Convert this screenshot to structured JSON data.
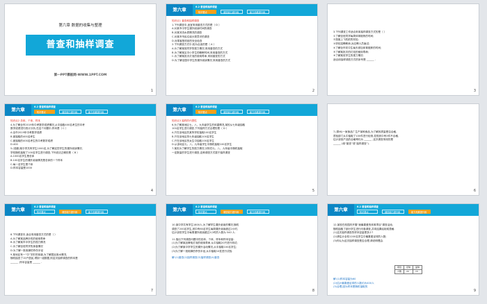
{
  "header": {
    "chapter": "第六章",
    "section": "6.2 普查和抽样调查",
    "tabs": [
      "知识要点",
      "课堂能力提升练",
      "能力拓展提升练"
    ]
  },
  "slides": [
    {
      "num": "1",
      "crumb": "第六章 数据的收集与整理",
      "title": "普查和抽样调查",
      "site": "第一PPT模板网-WWW.1PPT.COM"
    },
    {
      "num": "2",
      "lines": [
        "知识点1 普查和抽样调查",
        "1.下列调查中,适宜采用普查方式的是（ D ）",
        "A.对某市中学生课外阅读时间的调查",
        "B.对某河流水质情况的调查",
        "C.对某市市民垃圾分类意识的调查",
        "D.对乘客登机前的安全检查",
        "2.下列调查方式中,较为合适的是（ A ）",
        "A.为了解某班同学的视力情况,采用普查的方式",
        "B.为了解某区中小学生的睡眠时间,采用普查的方式",
        "C.为了解某批次灯泡的使用寿命,采用普查的方式",
        "D.为了解全国中学生的课外阅读情况,采用普查的方式"
      ]
    },
    {
      "num": "3",
      "lines": [
        "3.下列调查工作适合采用抽样调查方式的是（ ）",
        "①了解全班同学每周体育锻炼的时间;",
        "②旅客上飞机前的安检;",
        "③学校招聘教师,对应聘人员面试;",
        "④了解全市初中生每天参加体育锻炼的时间;",
        "⑤了解某批次的灯泡的使用寿命;",
        "⑥了解某班学生的视力情况.",
        "适合用抽样调查方式的序号是 ______ ."
      ]
    },
    {
      "num": "4",
      "lines": [
        "知识点2 总体、个体、样本",
        "4.为了解全市2019年中考数学成绩情况,从中抽取400名考生的中考",
        "数学成绩进行统计分析,在这个问题中,样本是（ C ）",
        "A.全市2019年中考数学成绩",
        "B.被抽取的400名考生",
        "C.被抽取的400名考生的中考数学成绩",
        "D.400",
        "5.(成都)某中学共有学生1000名,为了解这些学生的课外阅读情况,",
        "学校随机抽取了100名学生进行调查,下列说法正确的是（ B ）",
        "A.1000名学生是总体",
        "B.100名学生的课外阅读情况是总体的一个样本",
        "C.每一名学生是个体",
        "D.样本容量是1000"
      ]
    },
    {
      "num": "5",
      "lines": [
        "知识点3 抽样的代表性",
        "6.为了解某地区七、八、九年级学生的体重情况,某校从七年级抽取",
        "100名学生进行调查,下列抽样方式合理的是（ D ）",
        "A.只在该地区的某所学校抽取100名学生",
        "B.只在该地区的七年级抽取100名学生",
        "C.只在该地区的女生中抽取100名学生",
        "D.从该地区七、八、九年级学生中随机抽取100名学生",
        "7.某校为了解学生的视力情况,分别在七、八、九年级中随机抽取",
        "一定数量的学生进行调查,这种调查方式属于抽样调查"
      ]
    },
    {
      "num": "6",
      "lines": [
        "7.(泰州)一家食品厂生产某种食品,为了解其质量是否合格,",
        "质检部门从中抽取了100件进行检测,发现其中有3件不合格,",
        "估计该批产品的合格率约为 ______ ,这次调查采用的是",
        "______ (填“普查”或“抽样调查”)."
      ]
    },
    {
      "num": "7",
      "lines": [
        "8.下列调查中,适合采用普查方式的是（ ）",
        "A.为了解某品牌手机的使用寿命",
        "B.为了解某市中学生的视力情况",
        "C.为了解全班同学的身高情况",
        "D.为了解一批炮弹的杀伤半径",
        "9.某地区有一“中”字形的街道,为了解居民用水情况,",
        "随机抽查了15户居民,得到一组数据,则这次抽样调查的样本是",
        "______ ,样本容量是 ______ ."
      ]
    },
    {
      "num": "8",
      "lines": [
        "10.某中学共有学生1800人,为了解学生课外阅读的情况,随机",
        "调查了200名学生,其中有60名学生每周课外阅读超过2小时,",
        "估计该校学生中每周课外阅读超过2小时的人数为 540 人.",
        "11.指出下列调查问题中的总体、个体、样本和样本容量:",
        "(1)为了解某品牌电灯泡的使用寿命,从中抽取20只进行测试;",
        "(2)为了解某中学学生的课外活动情况,从中抽取100名学生;",
        "(3)为了解一批炮弹的杀伤半径,从中抽取10发进行试验.",
        "解:(1)普查(2)抽样调查(3)抽样调查(4)普查"
      ]
    },
    {
      "num": "9",
      "lines": [
        "12.某校在校园内开展“我最喜爱的体育项目”调查活动,",
        "随机抽取了部分学生进行问卷调查,并将结果绘制成表格.",
        "(1)这次抽样调查的样本容量是多少?",
        "(2)请估计全校1200名学生中最喜爱足球的人数;",
        "(3)你认为这次抽样调查是否合理,请说明理由.",
        "解:(1)样本容量为60",
        "(2)估计最喜爱足球的人数约为400人",
        "(3)合理,因为样本是随机抽取的"
      ],
      "table": [
        [
          "项目",
          "足球",
          "篮球"
        ],
        [
          "人数",
          "20",
          "15"
        ]
      ]
    }
  ]
}
